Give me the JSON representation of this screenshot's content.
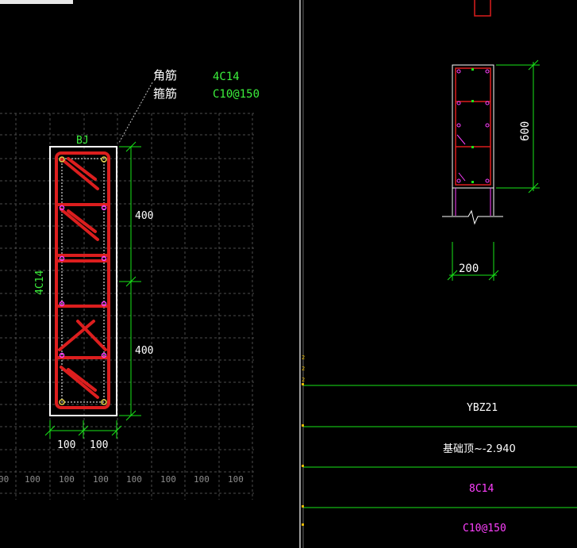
{
  "left_view": {
    "annotation": {
      "corner_label": "角筋",
      "corner_value": "4C14",
      "stirrup_label": "箍筋",
      "stirrup_value": "C10@150"
    },
    "section_label": "BJ",
    "side_label": "4C14",
    "dims_vertical": [
      "400",
      "400"
    ],
    "dims_horizontal": [
      "100",
      "100"
    ],
    "grid_row_labels": [
      "00",
      "100",
      "100",
      "100",
      "100",
      "100",
      "100",
      "100"
    ]
  },
  "right_view": {
    "dim_height": "600",
    "dim_width": "200",
    "table": {
      "name": "YBZ21",
      "elevation": "基础顶~-2.940",
      "longitudinal": "8C14",
      "stirrup": "C10@150"
    },
    "edge_marks": [
      "2",
      "2",
      "2"
    ]
  },
  "colors": {
    "background": "#000000",
    "rebar": "#dc1e1e",
    "dim_line": "#19e619",
    "text_white": "#ffffff",
    "text_green": "#3cf03c",
    "text_magenta": "#ff40ff",
    "grid": "#555555",
    "divider": "#cfcfcf"
  }
}
